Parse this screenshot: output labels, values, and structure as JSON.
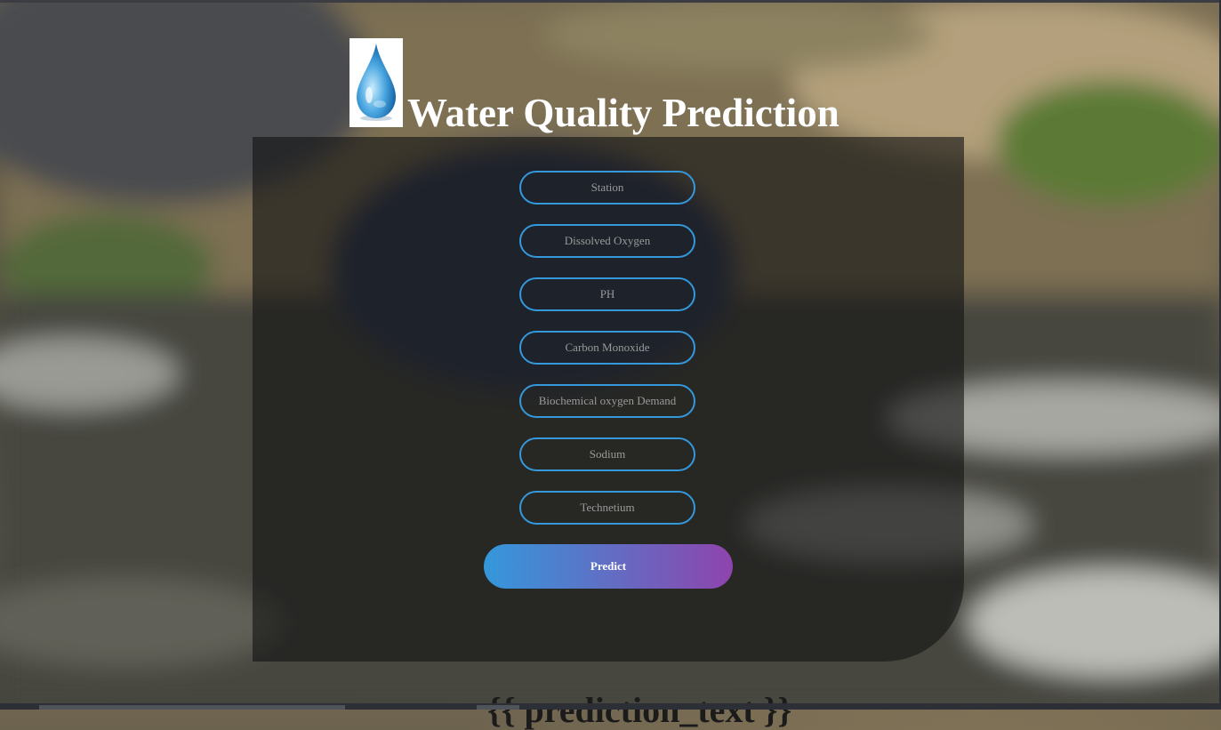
{
  "header": {
    "logo_icon": "water-drop-icon",
    "title": "Water Quality Prediction"
  },
  "form": {
    "fields": [
      {
        "placeholder": "Station"
      },
      {
        "placeholder": "Dissolved Oxygen"
      },
      {
        "placeholder": "PH"
      },
      {
        "placeholder": "Carbon Monoxide"
      },
      {
        "placeholder": "Biochemical oxygen Demand"
      },
      {
        "placeholder": "Sodium"
      },
      {
        "placeholder": "Technetium"
      }
    ],
    "submit_label": "Predict"
  },
  "result": {
    "text": "{{ prediction_text }}"
  },
  "colors": {
    "field_border": "#3498db",
    "button_gradient_start": "#3498db",
    "button_gradient_end": "#8e44ad"
  }
}
